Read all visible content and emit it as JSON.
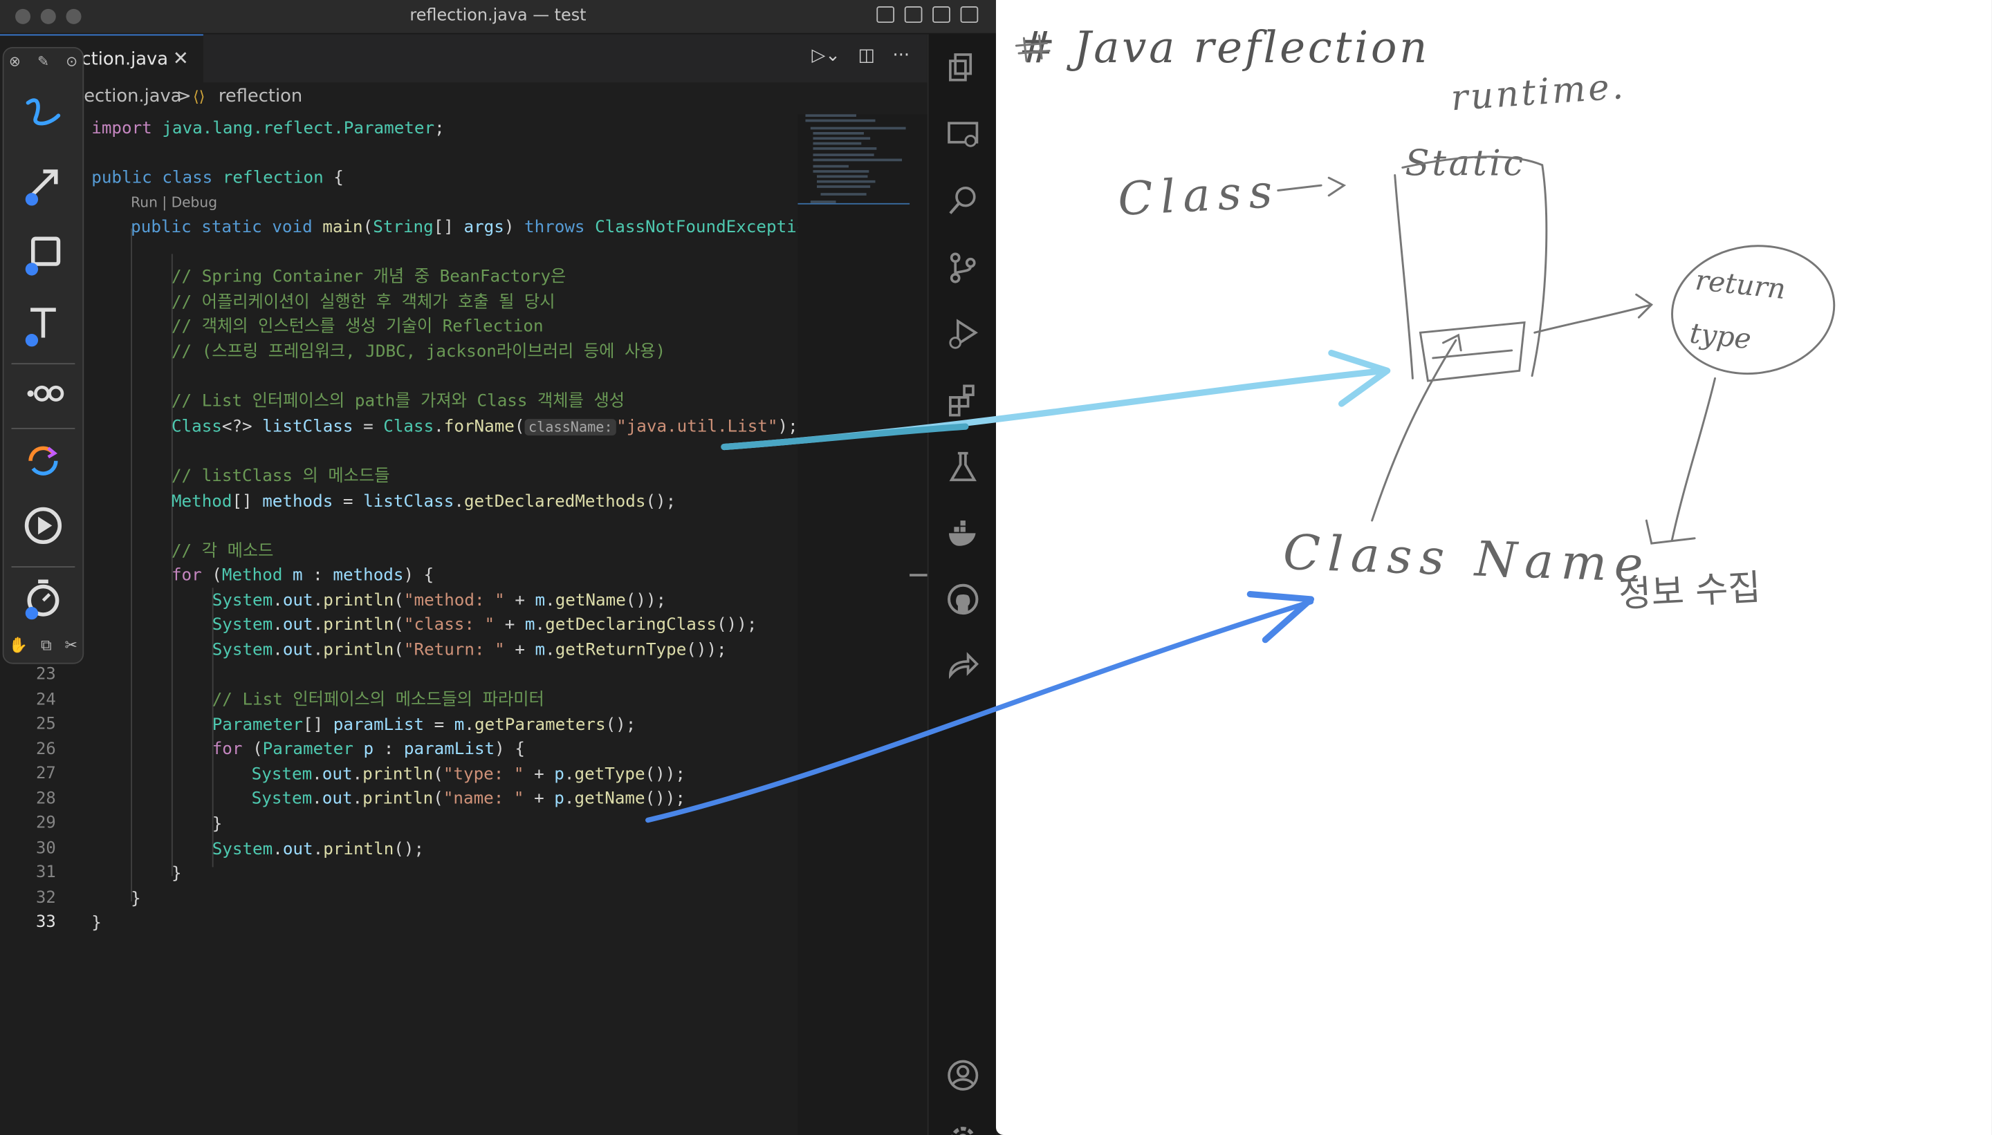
{
  "window": {
    "title": "reflection.java — test"
  },
  "tab": {
    "label": "ction.java",
    "close": "✕"
  },
  "breadcrumb": {
    "file": "ection.java",
    "sep": ">",
    "symbol": "reflection"
  },
  "codelens": "Run | Debug",
  "inlay_hint": "className:",
  "line_numbers": [
    "23",
    "24",
    "25",
    "26",
    "27",
    "28",
    "29",
    "30",
    "31",
    "32",
    "33"
  ],
  "code": {
    "l1": [
      "import ",
      "java.lang.reflect.Parameter",
      ";"
    ],
    "l2": [
      "public ",
      "class ",
      "reflection",
      " {"
    ],
    "l3": [
      "public ",
      "static ",
      "void ",
      "main",
      "(",
      "String",
      "[] ",
      "args",
      ") ",
      "throws ",
      "ClassNotFoundExceptio"
    ],
    "c1": "// Spring Container 개념 중 BeanFactory은",
    "c2": "// 어플리케이션이 실행한 후 객체가 호출 될 당시",
    "c3": "// 객체의 인스턴스를 생성 기술이 Reflection",
    "c4": "// (스프링 프레임워크, JDBC, jackson라이브러리 등에 사용)",
    "c5": "// List 인터페이스의 path를 가져와 Class 객체를 생성",
    "l4": [
      "Class",
      "<?> ",
      "listClass",
      " = ",
      "Class",
      ".",
      "forName",
      "(",
      "\"java.util.List\"",
      ");"
    ],
    "c6": "// listClass 의 메소드들",
    "l5": [
      "Method",
      "[] ",
      "methods",
      " = ",
      "listClass",
      ".",
      "getDeclaredMethods",
      "();"
    ],
    "c7": "// 각 메소드",
    "l6": [
      "for ",
      "(",
      "Method ",
      "m",
      " : ",
      "methods",
      ") {"
    ],
    "l7": [
      "System",
      ".",
      "out",
      ".",
      "println",
      "(",
      "\"method: \"",
      " + ",
      "m",
      ".",
      "getName",
      "());"
    ],
    "l8": [
      "System",
      ".",
      "out",
      ".",
      "println",
      "(",
      "\"class: \"",
      " + ",
      "m",
      ".",
      "getDeclaringClass",
      "());"
    ],
    "l9": [
      "System",
      ".",
      "out",
      ".",
      "println",
      "(",
      "\"Return: \"",
      " + ",
      "m",
      ".",
      "getReturnType",
      "());"
    ],
    "c8": "// List 인터페이스의 메소드들의 파라미터",
    "l10": [
      "Parameter",
      "[] ",
      "paramList",
      " = ",
      "m",
      ".",
      "getParameters",
      "();"
    ],
    "l11": [
      "for ",
      "(",
      "Parameter ",
      "p",
      " : ",
      "paramList",
      ") {"
    ],
    "l12": [
      "System",
      ".",
      "out",
      ".",
      "println",
      "(",
      "\"type: \"",
      " + ",
      "p",
      ".",
      "getType",
      "());"
    ],
    "l13": [
      "System",
      ".",
      "out",
      ".",
      "println",
      "(",
      "\"name: \"",
      " + ",
      "p",
      ".",
      "getName",
      "());"
    ],
    "l14": "}",
    "l15": [
      "System",
      ".",
      "out",
      ".",
      "println",
      "();"
    ],
    "l16": "}",
    "l17": "}",
    "l18": "}"
  },
  "whiteboard": {
    "title": "# Java reflection",
    "runtime": "runtime.",
    "class": "Class",
    "static": "Static",
    "return_type": "return type",
    "class_name": "Class Name",
    "note": "정보 수집"
  },
  "colors": {
    "annotation_cyan": "#7cc8e6",
    "annotation_blue": "#3b7be0"
  }
}
